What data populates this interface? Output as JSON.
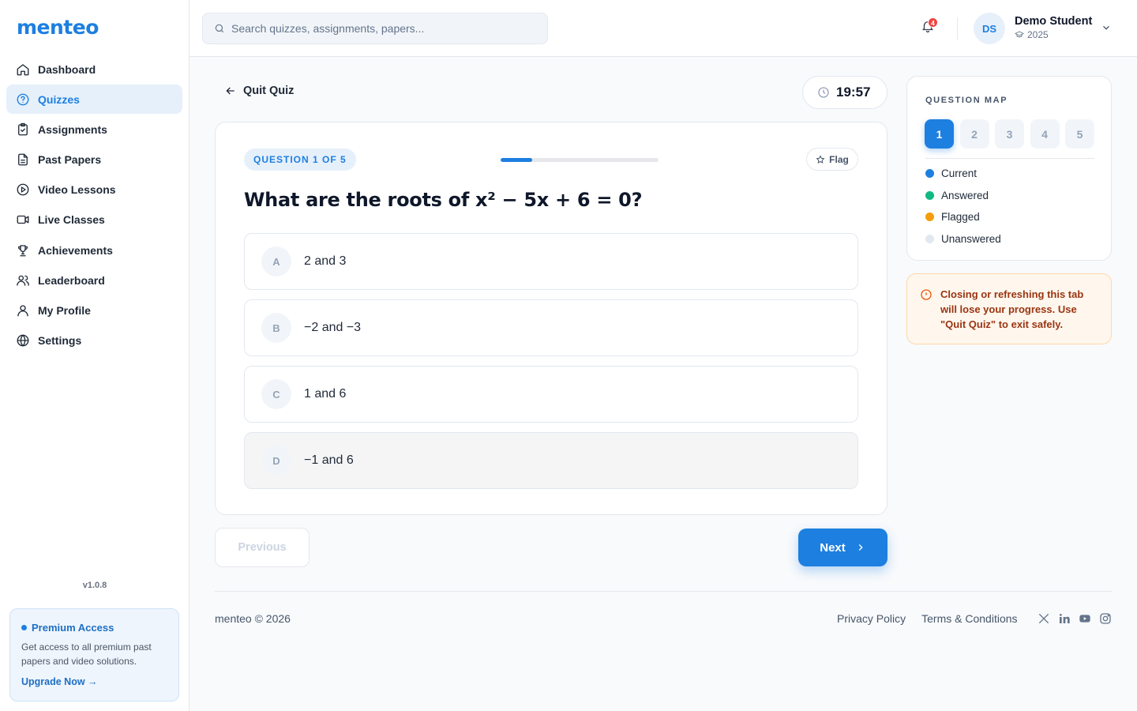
{
  "app": {
    "logo": "menteo",
    "version": "v1.0.8"
  },
  "sidebar": {
    "items": [
      {
        "label": "Dashboard",
        "icon": "home-icon"
      },
      {
        "label": "Quizzes",
        "icon": "help-circle-icon",
        "active": true
      },
      {
        "label": "Assignments",
        "icon": "clipboard-icon"
      },
      {
        "label": "Past Papers",
        "icon": "file-text-icon"
      },
      {
        "label": "Video Lessons",
        "icon": "play-circle-icon"
      },
      {
        "label": "Live Classes",
        "icon": "video-icon"
      },
      {
        "label": "Achievements",
        "icon": "trophy-icon"
      },
      {
        "label": "Leaderboard",
        "icon": "users-icon"
      },
      {
        "label": "My Profile",
        "icon": "user-icon"
      },
      {
        "label": "Settings",
        "icon": "globe-icon"
      }
    ],
    "premium": {
      "title": "Premium Access",
      "description": "Get access to all premium past papers and video solutions.",
      "link": "Upgrade Now →"
    }
  },
  "header": {
    "search_placeholder": "Search quizzes, assignments, papers...",
    "notification_count": "4",
    "user": {
      "initials": "DS",
      "name": "Demo Student",
      "year": "2025"
    }
  },
  "quiz": {
    "quit_label": "Quit Quiz",
    "timer": "19:57",
    "question_badge": "QUESTION 1 OF 5",
    "progress_fraction": 0.2,
    "flag_label": "Flag",
    "question": "What are the roots of x² − 5x + 6 = 0?",
    "options": [
      {
        "letter": "A",
        "text": "2 and 3"
      },
      {
        "letter": "B",
        "text": "−2 and −3"
      },
      {
        "letter": "C",
        "text": "1 and 6"
      },
      {
        "letter": "D",
        "text": "−1 and 6"
      }
    ],
    "prev_label": "Previous",
    "next_label": "Next"
  },
  "question_map": {
    "title": "QUESTION MAP",
    "numbers": [
      "1",
      "2",
      "3",
      "4",
      "5"
    ],
    "current": "1",
    "legend": [
      {
        "label": "Current",
        "color": "#1d7fe0"
      },
      {
        "label": "Answered",
        "color": "#10b981"
      },
      {
        "label": "Flagged",
        "color": "#f59e0b"
      },
      {
        "label": "Unanswered",
        "color": "#e2e8f0"
      }
    ]
  },
  "warning": {
    "text": "Closing or refreshing this tab will lose your progress. Use \"Quit Quiz\" to exit safely."
  },
  "footer": {
    "copyright": "menteo © 2026",
    "links": [
      "Privacy Policy",
      "Terms & Conditions"
    ],
    "social": [
      "x-icon",
      "linkedin-icon",
      "youtube-icon",
      "instagram-icon"
    ]
  }
}
